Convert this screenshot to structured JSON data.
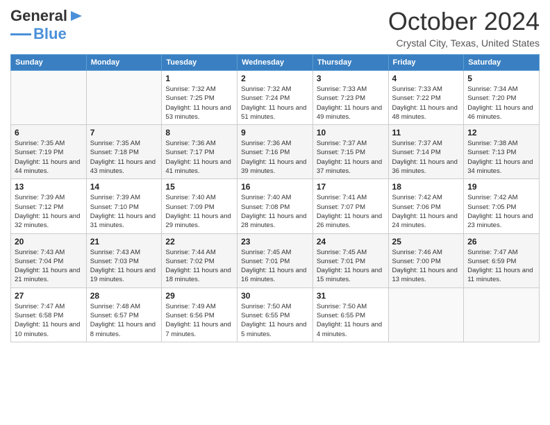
{
  "header": {
    "logo_general": "General",
    "logo_blue": "Blue",
    "month_title": "October 2024",
    "location": "Crystal City, Texas, United States"
  },
  "days_of_week": [
    "Sunday",
    "Monday",
    "Tuesday",
    "Wednesday",
    "Thursday",
    "Friday",
    "Saturday"
  ],
  "weeks": [
    [
      {
        "day": "",
        "info": ""
      },
      {
        "day": "",
        "info": ""
      },
      {
        "day": "1",
        "info": "Sunrise: 7:32 AM\nSunset: 7:25 PM\nDaylight: 11 hours and 53 minutes."
      },
      {
        "day": "2",
        "info": "Sunrise: 7:32 AM\nSunset: 7:24 PM\nDaylight: 11 hours and 51 minutes."
      },
      {
        "day": "3",
        "info": "Sunrise: 7:33 AM\nSunset: 7:23 PM\nDaylight: 11 hours and 49 minutes."
      },
      {
        "day": "4",
        "info": "Sunrise: 7:33 AM\nSunset: 7:22 PM\nDaylight: 11 hours and 48 minutes."
      },
      {
        "day": "5",
        "info": "Sunrise: 7:34 AM\nSunset: 7:20 PM\nDaylight: 11 hours and 46 minutes."
      }
    ],
    [
      {
        "day": "6",
        "info": "Sunrise: 7:35 AM\nSunset: 7:19 PM\nDaylight: 11 hours and 44 minutes."
      },
      {
        "day": "7",
        "info": "Sunrise: 7:35 AM\nSunset: 7:18 PM\nDaylight: 11 hours and 43 minutes."
      },
      {
        "day": "8",
        "info": "Sunrise: 7:36 AM\nSunset: 7:17 PM\nDaylight: 11 hours and 41 minutes."
      },
      {
        "day": "9",
        "info": "Sunrise: 7:36 AM\nSunset: 7:16 PM\nDaylight: 11 hours and 39 minutes."
      },
      {
        "day": "10",
        "info": "Sunrise: 7:37 AM\nSunset: 7:15 PM\nDaylight: 11 hours and 37 minutes."
      },
      {
        "day": "11",
        "info": "Sunrise: 7:37 AM\nSunset: 7:14 PM\nDaylight: 11 hours and 36 minutes."
      },
      {
        "day": "12",
        "info": "Sunrise: 7:38 AM\nSunset: 7:13 PM\nDaylight: 11 hours and 34 minutes."
      }
    ],
    [
      {
        "day": "13",
        "info": "Sunrise: 7:39 AM\nSunset: 7:12 PM\nDaylight: 11 hours and 32 minutes."
      },
      {
        "day": "14",
        "info": "Sunrise: 7:39 AM\nSunset: 7:10 PM\nDaylight: 11 hours and 31 minutes."
      },
      {
        "day": "15",
        "info": "Sunrise: 7:40 AM\nSunset: 7:09 PM\nDaylight: 11 hours and 29 minutes."
      },
      {
        "day": "16",
        "info": "Sunrise: 7:40 AM\nSunset: 7:08 PM\nDaylight: 11 hours and 28 minutes."
      },
      {
        "day": "17",
        "info": "Sunrise: 7:41 AM\nSunset: 7:07 PM\nDaylight: 11 hours and 26 minutes."
      },
      {
        "day": "18",
        "info": "Sunrise: 7:42 AM\nSunset: 7:06 PM\nDaylight: 11 hours and 24 minutes."
      },
      {
        "day": "19",
        "info": "Sunrise: 7:42 AM\nSunset: 7:05 PM\nDaylight: 11 hours and 23 minutes."
      }
    ],
    [
      {
        "day": "20",
        "info": "Sunrise: 7:43 AM\nSunset: 7:04 PM\nDaylight: 11 hours and 21 minutes."
      },
      {
        "day": "21",
        "info": "Sunrise: 7:43 AM\nSunset: 7:03 PM\nDaylight: 11 hours and 19 minutes."
      },
      {
        "day": "22",
        "info": "Sunrise: 7:44 AM\nSunset: 7:02 PM\nDaylight: 11 hours and 18 minutes."
      },
      {
        "day": "23",
        "info": "Sunrise: 7:45 AM\nSunset: 7:01 PM\nDaylight: 11 hours and 16 minutes."
      },
      {
        "day": "24",
        "info": "Sunrise: 7:45 AM\nSunset: 7:01 PM\nDaylight: 11 hours and 15 minutes."
      },
      {
        "day": "25",
        "info": "Sunrise: 7:46 AM\nSunset: 7:00 PM\nDaylight: 11 hours and 13 minutes."
      },
      {
        "day": "26",
        "info": "Sunrise: 7:47 AM\nSunset: 6:59 PM\nDaylight: 11 hours and 11 minutes."
      }
    ],
    [
      {
        "day": "27",
        "info": "Sunrise: 7:47 AM\nSunset: 6:58 PM\nDaylight: 11 hours and 10 minutes."
      },
      {
        "day": "28",
        "info": "Sunrise: 7:48 AM\nSunset: 6:57 PM\nDaylight: 11 hours and 8 minutes."
      },
      {
        "day": "29",
        "info": "Sunrise: 7:49 AM\nSunset: 6:56 PM\nDaylight: 11 hours and 7 minutes."
      },
      {
        "day": "30",
        "info": "Sunrise: 7:50 AM\nSunset: 6:55 PM\nDaylight: 11 hours and 5 minutes."
      },
      {
        "day": "31",
        "info": "Sunrise: 7:50 AM\nSunset: 6:55 PM\nDaylight: 11 hours and 4 minutes."
      },
      {
        "day": "",
        "info": ""
      },
      {
        "day": "",
        "info": ""
      }
    ]
  ]
}
